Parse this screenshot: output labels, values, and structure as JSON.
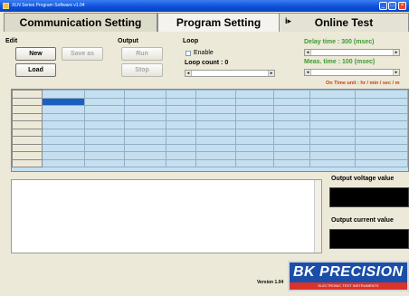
{
  "window": {
    "title": "XLN Series Program Software v1.04",
    "controls": [
      "_",
      "□",
      "×"
    ]
  },
  "tabs": {
    "communication": "Communication Setting",
    "program": "Program Setting",
    "online_arrow": "i▸",
    "online": "Online Test"
  },
  "edit": {
    "label": "Edit",
    "new": "New",
    "save_as": "Save as",
    "load": "Load"
  },
  "output": {
    "label": "Output",
    "run": "Run",
    "stop": "Stop"
  },
  "loop": {
    "label": "Loop",
    "enable": "Enable",
    "enable_checked": false,
    "count_label": "Loop count : 0"
  },
  "timing": {
    "delay": "Delay time : 300 (msec)",
    "meas": "Meas. time : 100 (msec)",
    "unit_note": "On Time unit : hr / min / sec / m"
  },
  "colors": {
    "green": "#3c9b32",
    "red": "#d03a10",
    "grid_bg": "#c5dff0",
    "selected_cell": "#1d5fbf"
  },
  "monitor": {
    "voltage_label": "Output voltage value",
    "current_label": "Output current value"
  },
  "footer": {
    "version": "Version 1.04",
    "logo": "BK PRECISION",
    "logo_sub": "ELECTRONIC TEST INSTRUMENTS"
  }
}
